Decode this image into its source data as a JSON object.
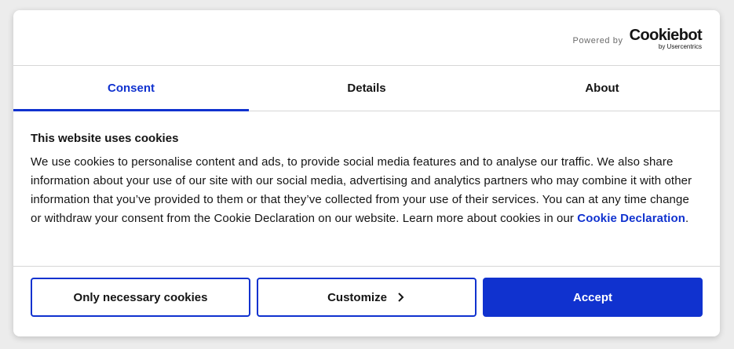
{
  "header": {
    "powered_by": "Powered by",
    "brand_name": "Cookiebot",
    "brand_sub": "by Usercentrics"
  },
  "tabs": [
    {
      "label": "Consent",
      "active": true
    },
    {
      "label": "Details",
      "active": false
    },
    {
      "label": "About",
      "active": false
    }
  ],
  "content": {
    "heading": "This website uses cookies",
    "paragraph": "We use cookies to personalise content and ads, to provide social media features and to analyse our traffic. We also share information about your use of our site with our social media, advertising and analytics partners who may combine it with other information that you’ve provided to them or that they’ve collected from your use of their services. You can at any time change or withdraw your consent from the Cookie Declaration on our website. Learn more about cookies in our ",
    "link": "Cookie Declaration",
    "period": "."
  },
  "buttons": {
    "necessary": "Only necessary cookies",
    "customize": "Customize",
    "accept": "Accept"
  },
  "colors": {
    "accent": "#1032cf",
    "text": "#141414",
    "divider": "#d6d6d6"
  }
}
